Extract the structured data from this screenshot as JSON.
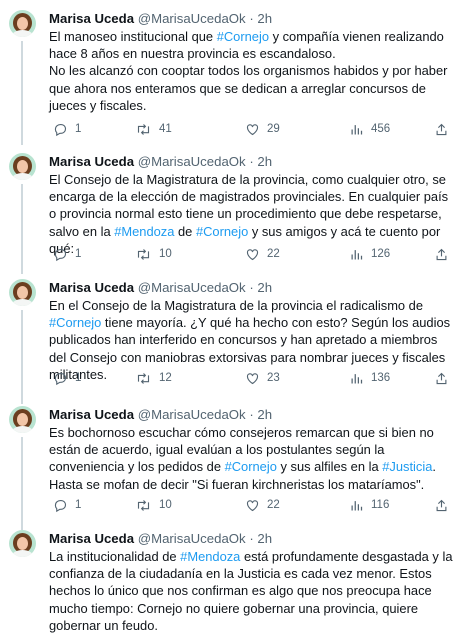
{
  "tweets": [
    {
      "name": "Marisa Uceda",
      "handle": "@MarisaUcedaOk",
      "separator": "·",
      "time": "2h",
      "parts": [
        {
          "t": "El manoseo institucional que "
        },
        {
          "t": "#Cornejo",
          "h": true
        },
        {
          "t": " y compañía vienen realizando hace 8 años en nuestra provincia es escandaloso.\nNo les alcanzó con cooptar todos los organismos habidos y por haber que ahora nos enteramos que se dedican a arreglar concursos de jueces y fiscales."
        }
      ],
      "reply_count": "1",
      "retweet_count": "41",
      "like_count": "29",
      "view_count": "456"
    },
    {
      "name": "Marisa Uceda",
      "handle": "@MarisaUcedaOk",
      "separator": "·",
      "time": "2h",
      "parts": [
        {
          "t": "El Consejo de la Magistratura de la provincia, como cualquier otro, se encarga de la elección de magistrados provinciales. En cualquier país o provincia normal esto tiene un procedimiento que debe respetarse, salvo en la "
        },
        {
          "t": "#Mendoza",
          "h": true
        },
        {
          "t": " de "
        },
        {
          "t": "#Cornejo",
          "h": true
        },
        {
          "t": " y sus amigos y acá te cuento por qué:"
        }
      ],
      "reply_count": "1",
      "retweet_count": "10",
      "like_count": "22",
      "view_count": "126"
    },
    {
      "name": "Marisa Uceda",
      "handle": "@MarisaUcedaOk",
      "separator": "·",
      "time": "2h",
      "parts": [
        {
          "t": "En el Consejo de la Magistratura de la provincia el radicalismo de "
        },
        {
          "t": "#Cornejo",
          "h": true
        },
        {
          "t": " tiene mayoría. ¿Y qué ha hecho con esto? Según los audios publicados han interferido en concursos y han apretado a miembros del Consejo con maniobras extorsivas para nombrar jueces y fiscales militantes."
        }
      ],
      "reply_count": "1",
      "retweet_count": "12",
      "like_count": "23",
      "view_count": "136"
    },
    {
      "name": "Marisa Uceda",
      "handle": "@MarisaUcedaOk",
      "separator": "·",
      "time": "2h",
      "parts": [
        {
          "t": "Es bochornoso escuchar cómo consejeros remarcan que si bien no están de acuerdo, igual evalúan a los postulantes según la conveniencia y los pedidos de "
        },
        {
          "t": "#Cornejo",
          "h": true
        },
        {
          "t": " y sus alfiles en la "
        },
        {
          "t": "#Justicia",
          "h": true
        },
        {
          "t": ". Hasta se mofan de decir \"Si fueran kirchneristas los mataríamos\"."
        }
      ],
      "reply_count": "1",
      "retweet_count": "10",
      "like_count": "22",
      "view_count": "116"
    },
    {
      "name": "Marisa Uceda",
      "handle": "@MarisaUcedaOk",
      "separator": "·",
      "time": "2h",
      "parts": [
        {
          "t": "La institucionalidad de "
        },
        {
          "t": "#Mendoza",
          "h": true
        },
        {
          "t": " está profundamente desgastada y la confianza de la ciudadanía en la Justicia es cada vez menor. Estos hechos lo único que nos confirman es algo que nos preocupa hace mucho tiempo: Cornejo no quiere gobernar una provincia, quiere gobernar un feudo."
        }
      ]
    }
  ],
  "colors": {
    "hashtag": "#1d9bf0",
    "text": "#0f1419",
    "secondary": "#536471",
    "thread_line": "#cfd9de"
  }
}
